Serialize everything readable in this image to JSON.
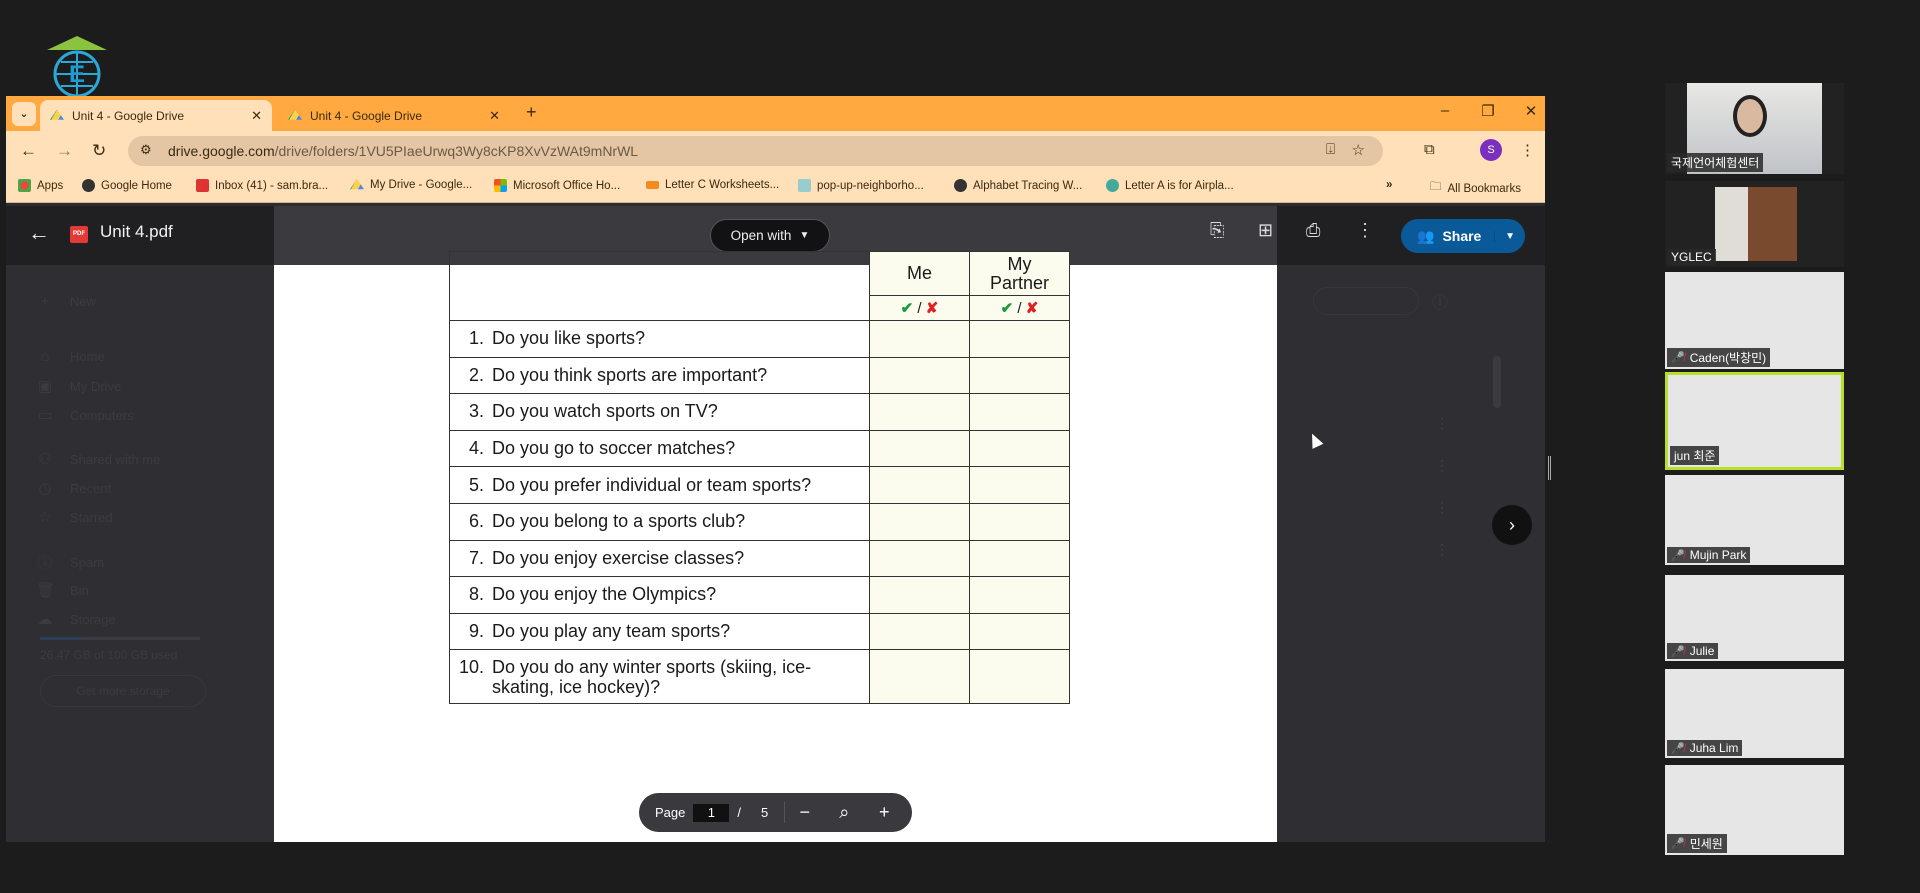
{
  "browser": {
    "tabs": [
      {
        "label": "Unit 4 - Google Drive",
        "active": true
      },
      {
        "label": "Unit 4 - Google Drive",
        "active": false
      }
    ],
    "url_host": "drive.google.com",
    "url_path": "/drive/folders/1VU5PIaeUrwq3Wy8cKP8XvVzWAt9mNrWL",
    "profile_initial": "S",
    "bookmarks": [
      "Apps",
      "Google Home",
      "Inbox (41) - sam.bra...",
      "My Drive - Google...",
      "Microsoft Office Ho...",
      "Letter C Worksheets...",
      "pop-up-neighborho...",
      "Alphabet Tracing W...",
      "Letter A is for Airpla..."
    ],
    "bookmarks_more": "»",
    "all_bookmarks": "All Bookmarks",
    "theme_color": "#ffa940"
  },
  "drive": {
    "file_name": "Unit 4.pdf",
    "file_type": "PDF",
    "open_with": "Open with",
    "share": "Share",
    "sidebar": [
      "New",
      "Home",
      "My Drive",
      "Computers",
      "Shared with me",
      "Recent",
      "Starred",
      "Spam",
      "Bin",
      "Storage"
    ],
    "storage_text": "26.47 GB of 100 GB used",
    "storage_fraction": 0.2647,
    "get_storage": "Get more storage"
  },
  "worksheet": {
    "col_me": "Me",
    "col_partner": "My Partner",
    "check": "✔",
    "slash": "/",
    "cross": "✘",
    "questions": [
      {
        "n": "1.",
        "q": "Do you like sports?"
      },
      {
        "n": "2.",
        "q": "Do you think sports are important?"
      },
      {
        "n": "3.",
        "q": "Do you watch sports on TV?"
      },
      {
        "n": "4.",
        "q": "Do you go to soccer matches?"
      },
      {
        "n": "5.",
        "q": "Do you prefer individual or team sports?"
      },
      {
        "n": "6.",
        "q": "Do you belong to a sports club?"
      },
      {
        "n": "7.",
        "q": "Do you enjoy exercise classes?"
      },
      {
        "n": "8.",
        "q": "Do you enjoy the Olympics?"
      },
      {
        "n": "9.",
        "q": "Do you play any team sports?"
      },
      {
        "n": "10.",
        "q": "Do you do any winter sports (skiing, ice-skating, ice hockey)?"
      }
    ]
  },
  "pager": {
    "label": "Page",
    "current": "1",
    "sep": "/",
    "total": "5"
  },
  "participants": [
    {
      "name": "국제언어체험센터",
      "muted": false,
      "video": true
    },
    {
      "name": "YGLEC",
      "muted": false,
      "video": true
    },
    {
      "name": "Caden(박창민)",
      "muted": true
    },
    {
      "name": "jun 최준",
      "muted": false,
      "speaking": true
    },
    {
      "name": "Mujin Park",
      "muted": true
    },
    {
      "name": "Julie",
      "muted": true
    },
    {
      "name": "Juha Lim",
      "muted": true
    },
    {
      "name": "민세원",
      "muted": true
    }
  ]
}
